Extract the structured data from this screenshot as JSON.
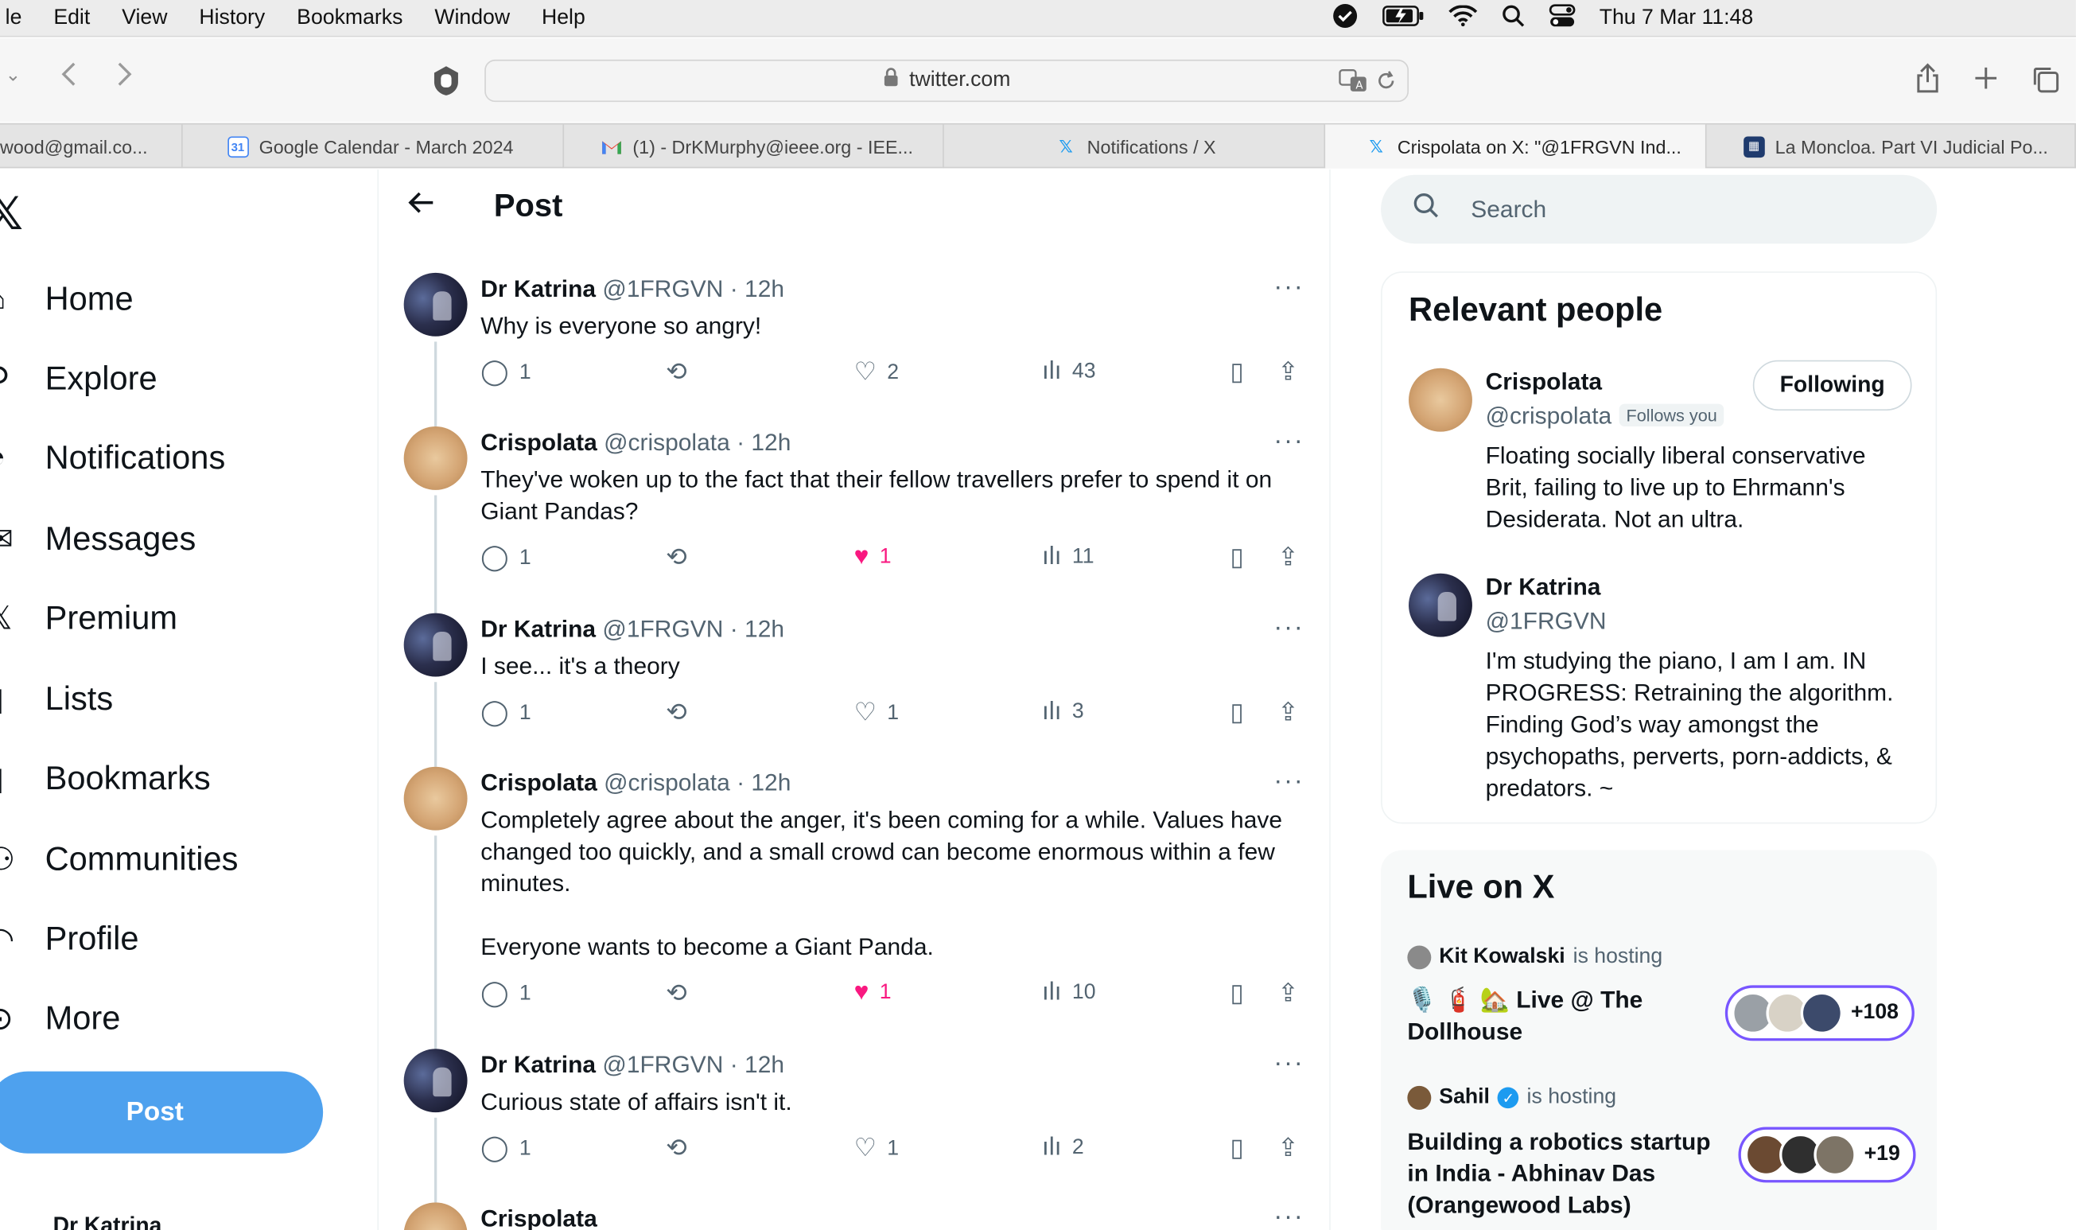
{
  "menubar": {
    "items": [
      "le",
      "Edit",
      "View",
      "History",
      "Bookmarks",
      "Window",
      "Help"
    ],
    "clock": "Thu 7 Mar  11:48"
  },
  "browser": {
    "url": "twitter.com",
    "tabs": [
      {
        "label": "wood@gmail.co...",
        "icon": "gmail-icon"
      },
      {
        "label": "Google Calendar - March 2024",
        "icon": "calendar-icon",
        "icon_text": "31"
      },
      {
        "label": "(1) - DrKMurphy@ieee.org - IEE...",
        "icon": "gmail-icon"
      },
      {
        "label": "Notifications / X",
        "icon": "x-icon"
      },
      {
        "label": "Crispolata on X: \"@1FRGVN Ind...",
        "icon": "x-icon"
      },
      {
        "label": "La Moncloa. Part VI Judicial Po...",
        "icon": "moncloa-icon"
      }
    ]
  },
  "nav": {
    "items": [
      {
        "label": "Home",
        "icon": "home-icon"
      },
      {
        "label": "Explore",
        "icon": "search-icon"
      },
      {
        "label": "Notifications",
        "icon": "bell-icon"
      },
      {
        "label": "Messages",
        "icon": "mail-icon"
      },
      {
        "label": "Premium",
        "icon": "x-logo-icon"
      },
      {
        "label": "Lists",
        "icon": "list-icon"
      },
      {
        "label": "Bookmarks",
        "icon": "bookmark-icon"
      },
      {
        "label": "Communities",
        "icon": "people-icon"
      },
      {
        "label": "Profile",
        "icon": "person-icon"
      },
      {
        "label": "More",
        "icon": "more-circle-icon"
      }
    ],
    "post_label": "Post",
    "account_name": "Dr Katrina"
  },
  "header": {
    "title": "Post"
  },
  "tweets": [
    {
      "name": "Dr Katrina",
      "handle": "@1FRGVN",
      "time": "· 12h",
      "text": "Why is everyone so angry!",
      "replies": "1",
      "likes": "2",
      "views": "43",
      "liked": false
    },
    {
      "name": "Crispolata",
      "handle": "@crispolata",
      "time": "· 12h",
      "text": "They've woken up to the fact that their fellow travellers prefer to spend it on Giant Pandas?",
      "replies": "1",
      "likes": "1",
      "views": "11",
      "liked": true
    },
    {
      "name": "Dr Katrina",
      "handle": "@1FRGVN",
      "time": "· 12h",
      "text": "I see... it's a theory",
      "replies": "1",
      "likes": "1",
      "views": "3",
      "liked": false
    },
    {
      "name": "Crispolata",
      "handle": "@crispolata",
      "time": "· 12h",
      "text": "Completely agree about the anger, it's been coming for a while. Values have changed too quickly, and a small crowd can become enormous within a few minutes.\n\nEveryone wants to become a Giant Panda.",
      "replies": "1",
      "likes": "1",
      "views": "10",
      "liked": true
    },
    {
      "name": "Dr Katrina",
      "handle": "@1FRGVN",
      "time": "· 12h",
      "text": "Curious state of affairs isn't it.",
      "replies": "1",
      "likes": "1",
      "views": "2",
      "liked": false
    },
    {
      "name": "Crispolata"
    }
  ],
  "search": {
    "placeholder": "Search"
  },
  "relevant": {
    "title": "Relevant people",
    "people": [
      {
        "name": "Crispolata",
        "handle": "@crispolata",
        "follows_you": "Follows you",
        "button": "Following",
        "bio": "Floating socially liberal conservative Brit, failing to live up to Ehrmann's Desiderata. Not an ultra."
      },
      {
        "name": "Dr Katrina",
        "handle": "@1FRGVN",
        "bio": "I'm studying the piano, I am I am. IN PROGRESS: Retraining the algorithm. Finding God’s way amongst the psychopaths, perverts, porn-addicts, & predators. ~"
      }
    ]
  },
  "live": {
    "title": "Live on X",
    "spaces": [
      {
        "host": "Kit Kowalski",
        "hosting": "is hosting",
        "title": "🎙️ 🧯 🏡 Live @ The Dollhouse",
        "count": "+108"
      },
      {
        "host": "Sahil",
        "hosting": "is hosting",
        "title": "Building a robotics startup in India - Abhinav Das (Orangewood Labs)",
        "count": "+19"
      }
    ]
  },
  "colors": {
    "accent": "#1d9bf0",
    "post_button": "#4ea1ee",
    "like": "#f91880",
    "spaces": "#7856ff"
  }
}
